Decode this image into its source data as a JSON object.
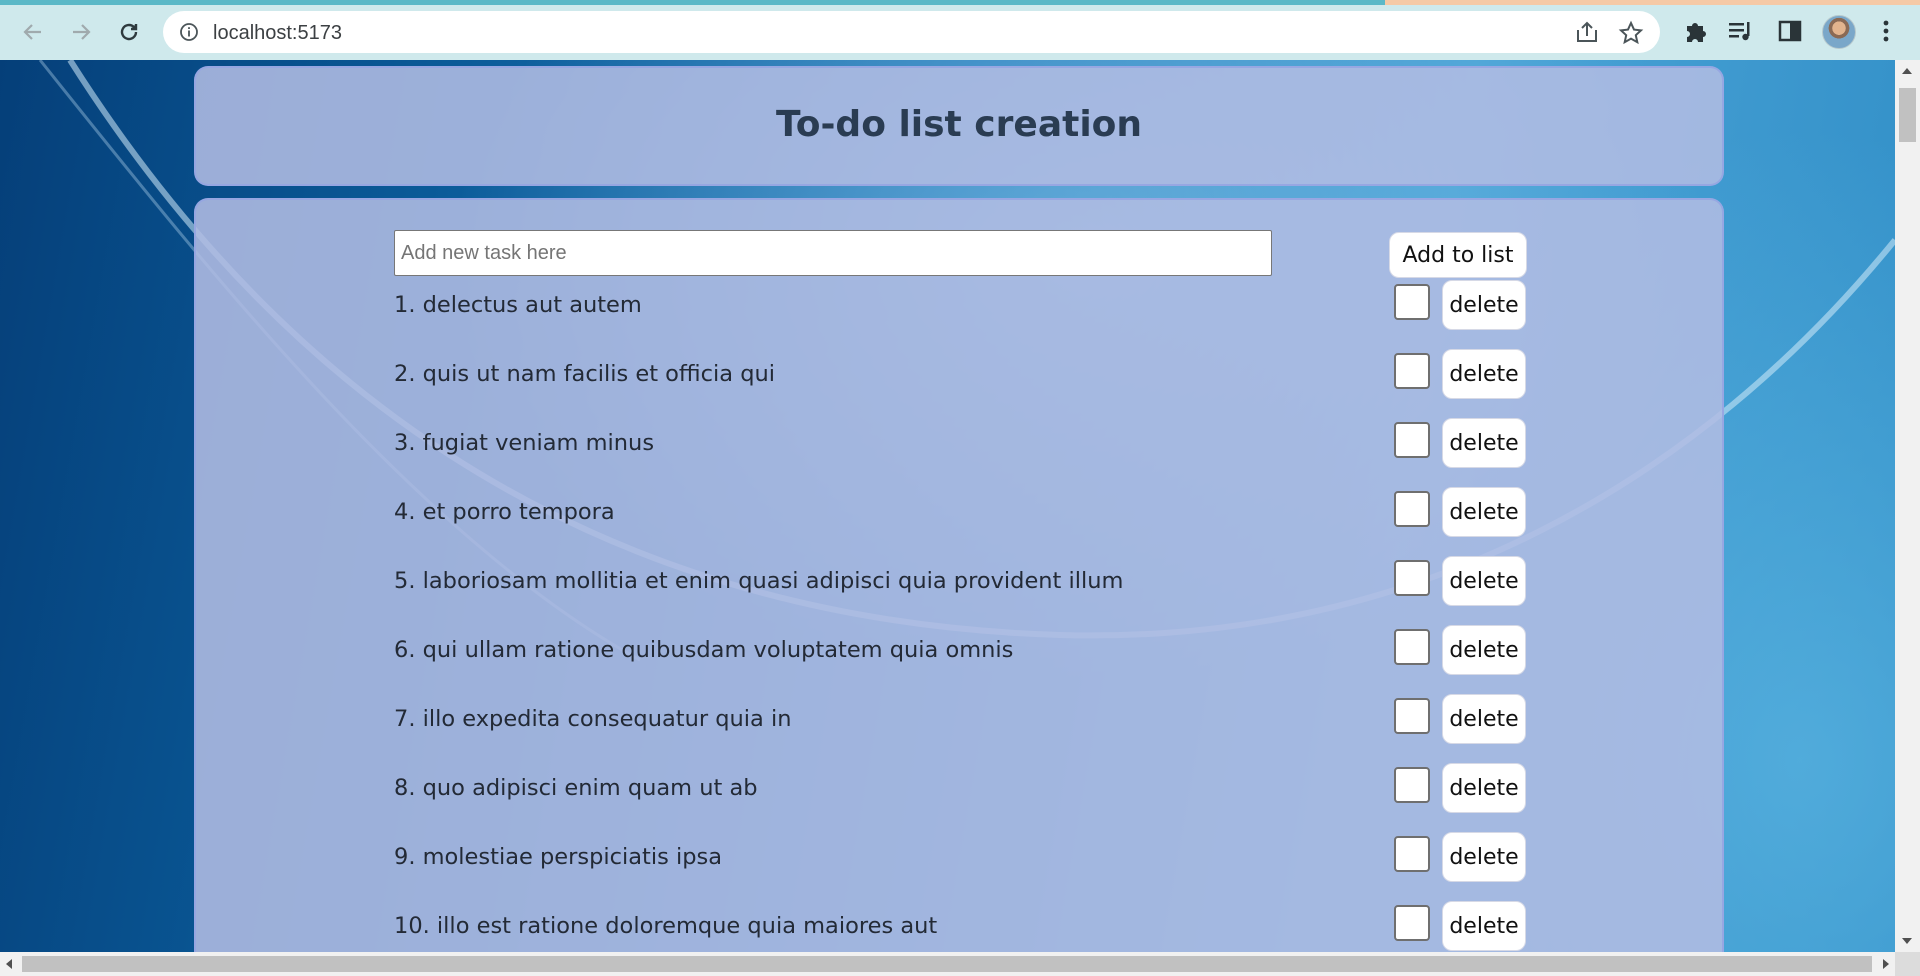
{
  "browser": {
    "url": "localhost:5173",
    "icons": {
      "back": "arrow-left-icon",
      "forward": "arrow-right-icon",
      "reload": "reload-icon",
      "site_info": "info-icon",
      "share": "share-icon",
      "bookmark": "star-icon",
      "extensions": "puzzle-icon",
      "media": "media-queue-icon",
      "side_panel": "side-panel-icon",
      "menu": "kebab-menu-icon"
    }
  },
  "colors": {
    "panel": "#b0bce2",
    "title": "#2a3c52",
    "load_bar": "#5bb8c7"
  },
  "header": {
    "title": "To-do list creation"
  },
  "form": {
    "placeholder": "Add new task here",
    "value": "",
    "add_label": "Add to list"
  },
  "tasks": [
    {
      "text": "1. delectus aut autem",
      "checked": false,
      "delete_label": "delete"
    },
    {
      "text": "2. quis ut nam facilis et officia qui",
      "checked": false,
      "delete_label": "delete"
    },
    {
      "text": "3. fugiat veniam minus",
      "checked": false,
      "delete_label": "delete"
    },
    {
      "text": "4. et porro tempora",
      "checked": false,
      "delete_label": "delete"
    },
    {
      "text": "5. laboriosam mollitia et enim quasi adipisci quia provident illum",
      "checked": false,
      "delete_label": "delete"
    },
    {
      "text": "6. qui ullam ratione quibusdam voluptatem quia omnis",
      "checked": false,
      "delete_label": "delete"
    },
    {
      "text": "7. illo expedita consequatur quia in",
      "checked": false,
      "delete_label": "delete"
    },
    {
      "text": "8. quo adipisci enim quam ut ab",
      "checked": false,
      "delete_label": "delete"
    },
    {
      "text": "9. molestiae perspiciatis ipsa",
      "checked": false,
      "delete_label": "delete"
    },
    {
      "text": "10. illo est ratione doloremque quia maiores aut",
      "checked": false,
      "delete_label": "delete"
    }
  ]
}
